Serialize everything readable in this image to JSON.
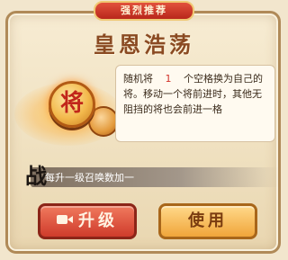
{
  "ribbon": {
    "label": "强烈推荐"
  },
  "card": {
    "title": "皇恩浩荡",
    "piece_char": "将"
  },
  "description": {
    "part1": "随机将",
    "count": "1",
    "part2": "个空格换为自己的将。移动一个将前进时，其他无阻挡的将也会前进一格"
  },
  "level_bar": {
    "icon_char": "战",
    "text": "每升一级召唤数加一"
  },
  "buttons": {
    "upgrade_label": "升级",
    "use_label": "使用"
  },
  "icons": {
    "video": "video-camera-icon",
    "battle": "battle-icon"
  },
  "colors": {
    "accent_red": "#cf3b2b",
    "accent_gold": "#f0a53a",
    "number_red": "#d2322a"
  }
}
